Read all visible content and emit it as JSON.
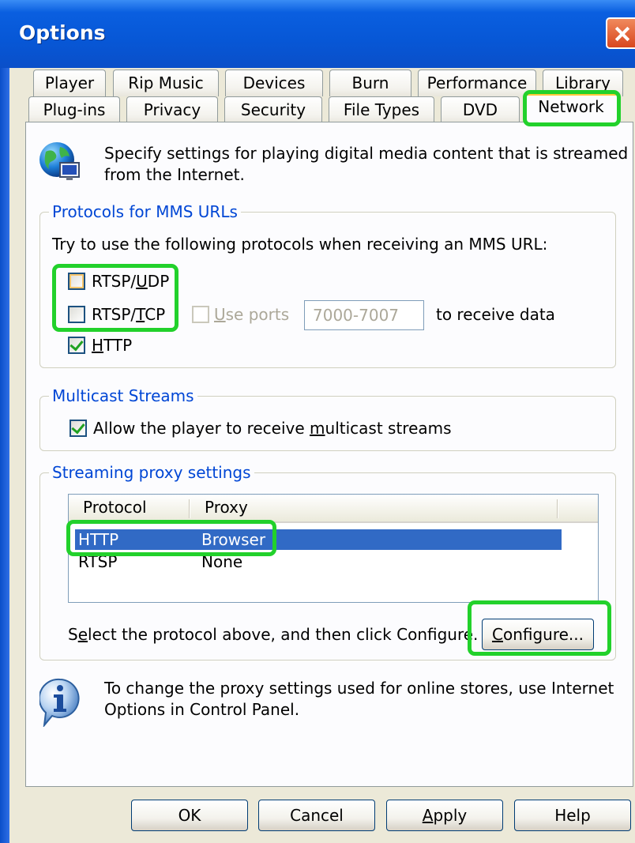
{
  "window": {
    "title": "Options"
  },
  "tabs_row1": [
    {
      "label": "Player"
    },
    {
      "label": "Rip Music"
    },
    {
      "label": "Devices"
    },
    {
      "label": "Burn"
    },
    {
      "label": "Performance"
    },
    {
      "label": "Library"
    }
  ],
  "tabs_row2": [
    {
      "label": "Plug-ins"
    },
    {
      "label": "Privacy"
    },
    {
      "label": "Security"
    },
    {
      "label": "File Types"
    },
    {
      "label": "DVD"
    },
    {
      "label": "Network",
      "active": true
    }
  ],
  "network": {
    "intro_line1": "Specify settings for playing digital media content that is streamed",
    "intro_line2": "from the Internet.",
    "protocols": {
      "title": "Protocols for MMS URLs",
      "instruction": "Try to use the following protocols when receiving an MMS URL:",
      "rtsp_udp": {
        "pre": "RTSP/",
        "accel": "U",
        "post": "DP",
        "checked": false
      },
      "rtsp_tcp": {
        "pre": "RTSP/",
        "accel": "T",
        "post": "CP",
        "checked": false
      },
      "use_ports": {
        "pre": "",
        "accel": "U",
        "post": "se ports",
        "checked": false,
        "enabled": false
      },
      "ports_value": "7000-7007",
      "receive_label": "to receive data",
      "http": {
        "pre": "",
        "accel": "H",
        "post": "TTP",
        "checked": true
      }
    },
    "multicast": {
      "title": "Multicast Streams",
      "allow": {
        "pre": "Allow the player to receive ",
        "accel": "m",
        "post": "ulticast streams",
        "checked": true
      }
    },
    "proxy": {
      "title": "Streaming proxy settings",
      "columns": [
        "Protocol",
        "Proxy"
      ],
      "rows": [
        {
          "protocol": "HTTP",
          "proxy": "Browser",
          "selected": true
        },
        {
          "protocol": "RTSP",
          "proxy": "None",
          "selected": false
        }
      ],
      "hint_pre": "S",
      "hint_accel": "e",
      "hint_post": "lect the protocol above, and then click Configure.",
      "configure": {
        "accel": "C",
        "post": "onfigure..."
      }
    },
    "info_line1": "To change the proxy settings used for online stores, use Internet",
    "info_line2": "Options in Control Panel."
  },
  "buttons": {
    "ok": "OK",
    "cancel": "Cancel",
    "apply": {
      "accel": "A",
      "post": "pply"
    },
    "help": "Help"
  },
  "icons": {
    "globe": "network-globe-icon",
    "info": "info-icon",
    "close": "close-icon"
  },
  "colors": {
    "highlight_annotation": "#22d12b",
    "selection": "#316ac5",
    "group_title": "#0046d5",
    "titlebar": "#0757d6"
  }
}
